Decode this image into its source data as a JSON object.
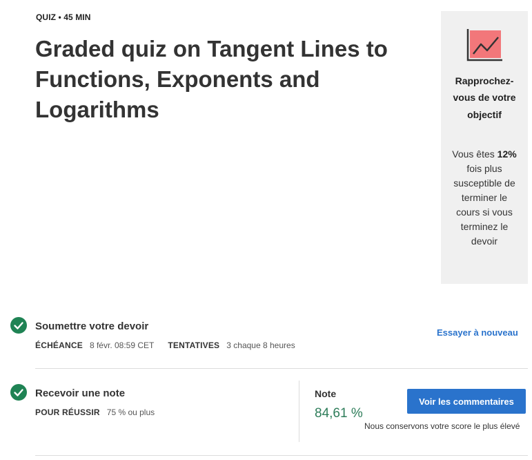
{
  "header": {
    "eyebrow": "QUIZ • 45 MIN",
    "title": "Graded quiz on Tangent Lines to Functions, Exponents and Logarithms"
  },
  "goal_card": {
    "icon": "chart-trend-icon",
    "heading": "Rapprochez-vous de votre objectif",
    "text_before": "Vous êtes",
    "highlight": "12%",
    "text_after": "fois plus susceptible de terminer le cours si vous terminez le devoir"
  },
  "submit_section": {
    "icon": "check-circle-icon",
    "title": "Soumettre votre devoir",
    "due_label": "ÉCHÉANCE",
    "due_value": "8 févr. 08:59 CET",
    "attempts_label": "TENTATIVES",
    "attempts_value": "3 chaque 8 heures",
    "retry_link": "Essayer à nouveau"
  },
  "grade_section": {
    "icon": "check-circle-icon",
    "title": "Recevoir une note",
    "pass_label": "POUR RÉUSSIR",
    "pass_value": "75 % ou plus",
    "grade_label": "Note",
    "grade_value": "84,61 %",
    "feedback_button": "Voir les commentaires",
    "keep_note": "Nous conservons votre score le plus élevé"
  },
  "colors": {
    "accent": "#2a73cc",
    "success": "#2e7d5a",
    "check": "#1f8354",
    "card_bg": "#f0f0f0",
    "icon_fill": "#f2777a"
  }
}
